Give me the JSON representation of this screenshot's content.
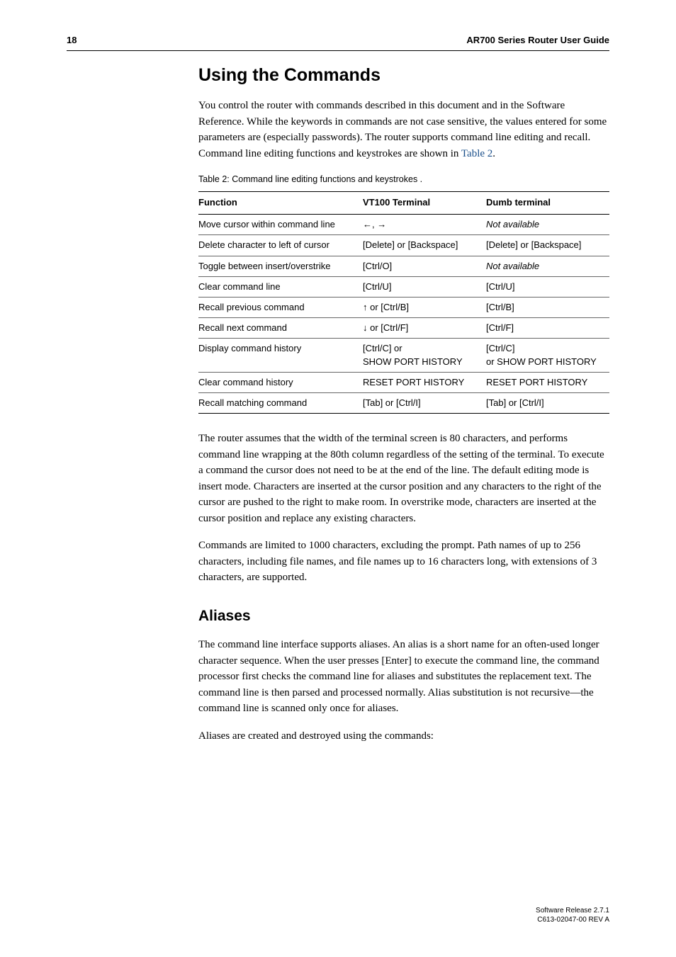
{
  "header": {
    "page_number": "18",
    "doc_title": "AR700 Series Router User Guide"
  },
  "section_title": "Using the Commands",
  "intro_para": "You control the router with commands described in this document and in the Software Reference. While the keywords in commands are not case sensitive, the values entered for some parameters are (especially passwords). The router supports command line editing and recall. Command line editing functions and keystrokes are shown in ",
  "intro_link": "Table 2",
  "intro_after": ".",
  "table_caption": "Table 2: Command line editing functions and keystrokes .",
  "table": {
    "headers": {
      "c0": "Function",
      "c1": "VT100 Terminal",
      "c2": "Dumb terminal"
    },
    "rows": [
      {
        "c0": "Move cursor within command line",
        "c1": "←, →",
        "c2": "Not available",
        "c2_italic": true
      },
      {
        "c0": "Delete character to left of cursor",
        "c1": "[Delete] or [Backspace]",
        "c2": "[Delete] or [Backspace]"
      },
      {
        "c0": "Toggle between insert/overstrike",
        "c1": "[Ctrl/O]",
        "c2": "Not available",
        "c2_italic": true
      },
      {
        "c0": "Clear command line",
        "c1": "[Ctrl/U]",
        "c2": "[Ctrl/U]"
      },
      {
        "c0": "Recall previous command",
        "c1": "↑ or [Ctrl/B]",
        "c2": "[Ctrl/B]"
      },
      {
        "c0": "Recall next command",
        "c1": "↓ or [Ctrl/F]",
        "c2": "[Ctrl/F]"
      },
      {
        "c0": "Display command history",
        "c1": "[Ctrl/C] or\nSHOW PORT HISTORY",
        "c2": "[Ctrl/C]\nor SHOW PORT HISTORY"
      },
      {
        "c0": "Clear command history",
        "c1": "RESET PORT HISTORY",
        "c2": "RESET PORT HISTORY"
      },
      {
        "c0": "Recall matching command",
        "c1": "[Tab] or [Ctrl/I]",
        "c2": "[Tab] or [Ctrl/I]"
      }
    ]
  },
  "para2": "The router assumes that the width of the terminal screen is 80 characters, and performs command line wrapping at the 80th column regardless of the setting of the terminal. To execute a command the cursor does not need to be at the end of the line. The default editing mode is insert mode. Characters are inserted at the cursor position and any characters to the right of the cursor are pushed to the right to make room. In overstrike mode, characters are inserted at the cursor position and replace any existing characters.",
  "para3": "Commands are limited to 1000 characters, excluding the prompt. Path names of up to 256 characters, including file names, and file names up to 16 characters long, with extensions of 3 characters, are supported.",
  "subsection_title": "Aliases",
  "para4": "The command line interface supports aliases. An alias is a short name for an often-used longer character sequence. When the user presses [Enter] to execute the command line, the command processor first checks the command line for aliases and substitutes the replacement text. The command line is then parsed and processed normally. Alias substitution is not recursive—the command line is scanned only once for aliases.",
  "para5": "Aliases are created and destroyed using the commands:",
  "footer": {
    "line1": "Software Release 2.7.1",
    "line2": "C613-02047-00 REV A"
  }
}
